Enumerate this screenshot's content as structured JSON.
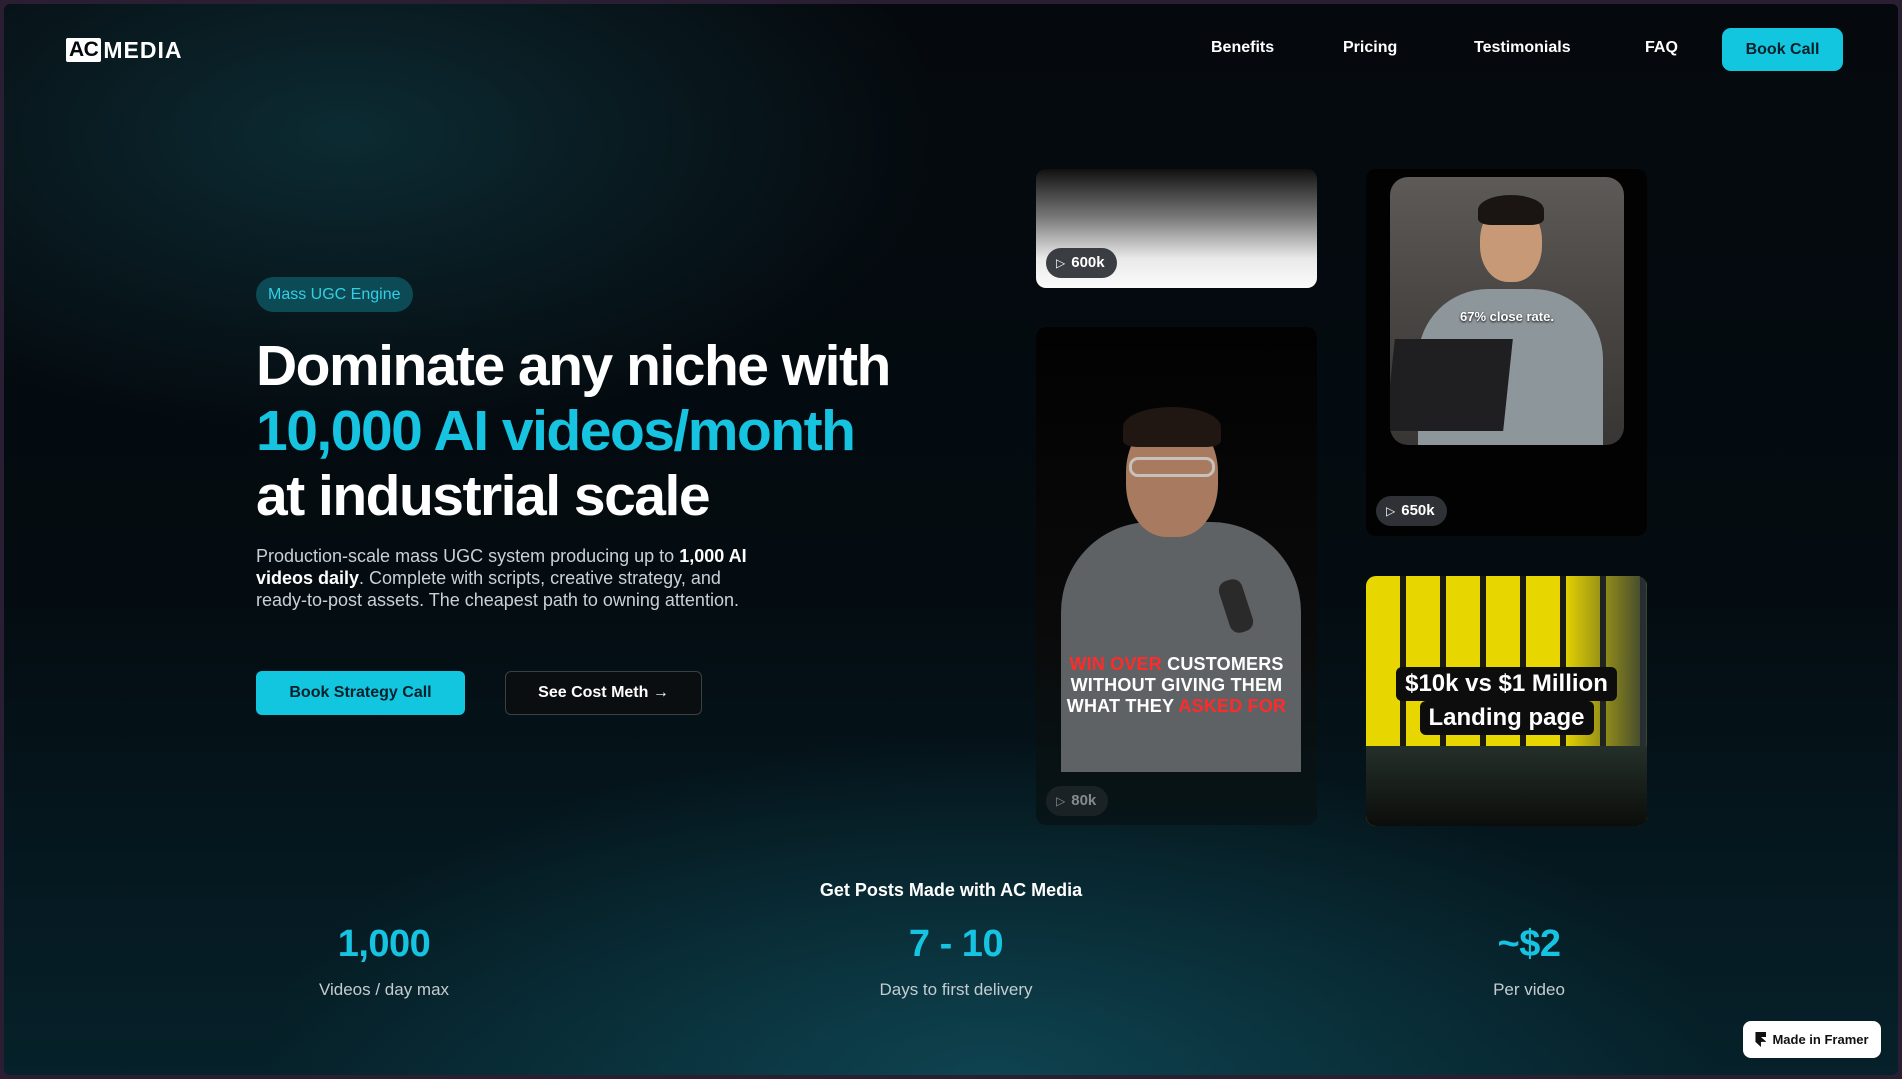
{
  "nav": {
    "logo_ac": "AC",
    "logo_media": "MEDIA",
    "links": [
      "Benefits",
      "Pricing",
      "Testimonials",
      "FAQ"
    ],
    "cta": "Book Call"
  },
  "hero": {
    "badge": "Mass UGC Engine",
    "title_line1": "Dominate any niche with",
    "title_line2": "10,000 AI videos/month",
    "title_line3": "at industrial scale",
    "sub_part1": "Production-scale mass UGC system producing up to ",
    "sub_bold": "1,000 AI videos daily",
    "sub_part2": ". Complete with scripts, creative strategy, and ready-to-post assets. The cheapest path to owning attention.",
    "primary_button": "Book Strategy Call",
    "secondary_button": "See Cost Meth →"
  },
  "videos": {
    "card1_views": "600k",
    "card2_views": "80k",
    "card2_caption_red1": "WIN OVER",
    "card2_caption_white1": " CUSTOMERS",
    "card2_caption_line2": "WITHOUT GIVING THEM",
    "card2_caption_white3": "WHAT THEY ",
    "card2_caption_red3": "ASKED FOR",
    "card3_views": "650k",
    "card3_overlay": "67% close rate.",
    "card4_line1": "$10k vs $1 Million",
    "card4_line2": "Landing page"
  },
  "stats": {
    "title": "Get Posts Made with AC Media",
    "items": [
      {
        "value": "1,000",
        "label": "Videos / day max"
      },
      {
        "value": "7 - 10",
        "label": "Days to first delivery"
      },
      {
        "value": "~$2",
        "label": "Per video"
      }
    ]
  },
  "framer": {
    "label": "Made in Framer"
  },
  "colors": {
    "accent": "#13c6e0",
    "background": "#05090d",
    "badge_bg": "#0c4a55"
  },
  "icons": {
    "play": "play-icon",
    "arrow": "arrow-right-icon",
    "framer": "framer-logo-icon"
  }
}
